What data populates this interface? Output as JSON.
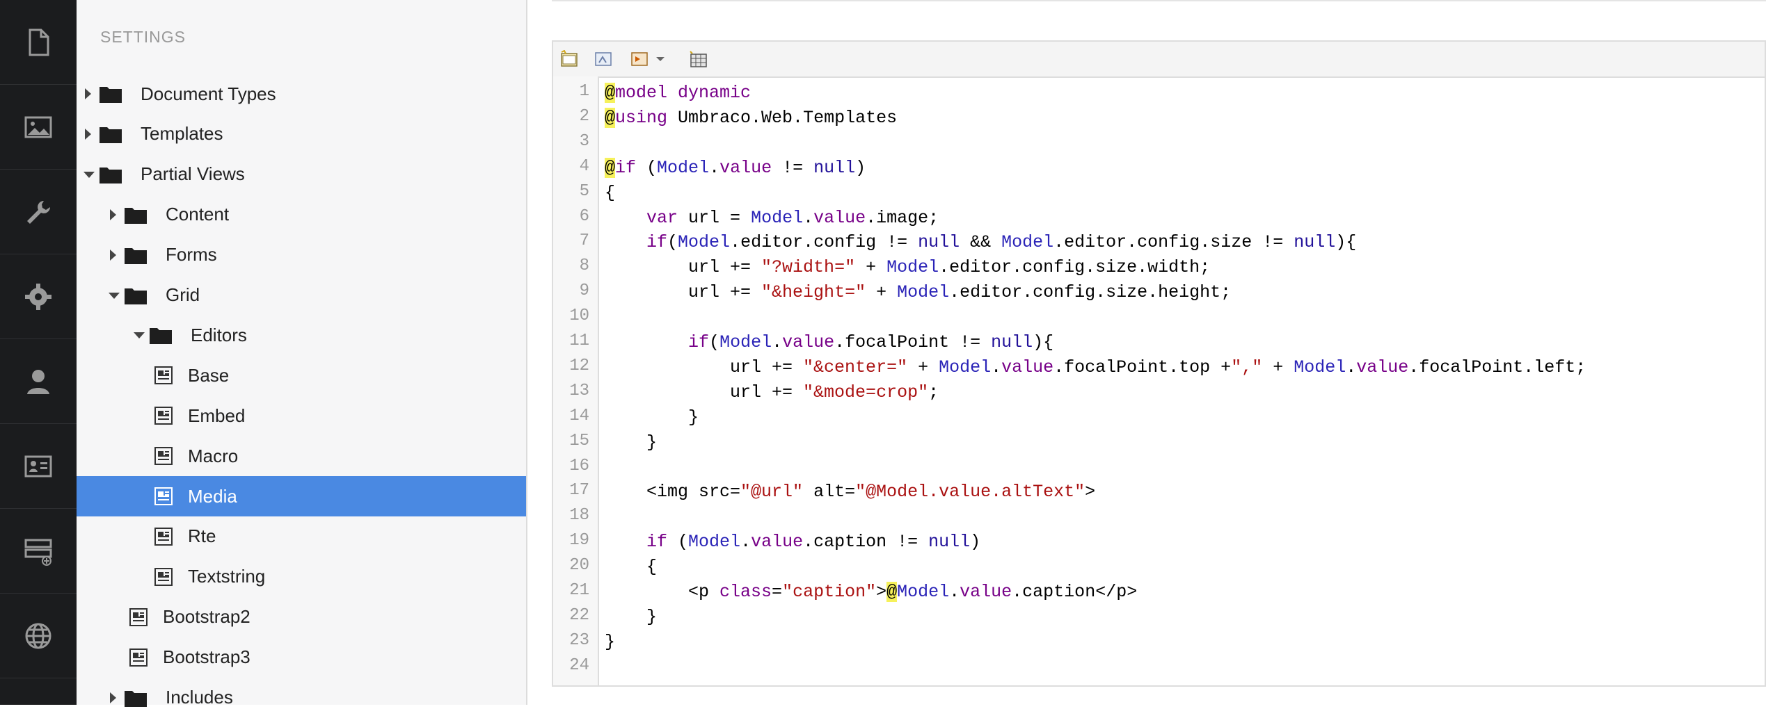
{
  "leftbar": {
    "icons": [
      "content-icon",
      "media-icon",
      "developer-icon",
      "settings-icon",
      "users-icon",
      "members-icon",
      "forms-icon",
      "translation-icon"
    ]
  },
  "tree": {
    "section_title": "SETTINGS",
    "items": [
      {
        "label": "Document Types",
        "type": "folder",
        "state": "collapsed",
        "depth": 0
      },
      {
        "label": "Templates",
        "type": "folder",
        "state": "collapsed",
        "depth": 0
      },
      {
        "label": "Partial Views",
        "type": "folder",
        "state": "expanded",
        "depth": 0
      },
      {
        "label": "Content",
        "type": "folder",
        "state": "collapsed",
        "depth": 1
      },
      {
        "label": "Forms",
        "type": "folder",
        "state": "collapsed",
        "depth": 1
      },
      {
        "label": "Grid",
        "type": "folder",
        "state": "expanded",
        "depth": 1
      },
      {
        "label": "Editors",
        "type": "folder",
        "state": "expanded",
        "depth": 2
      },
      {
        "label": "Base",
        "type": "file",
        "depth": 3
      },
      {
        "label": "Embed",
        "type": "file",
        "depth": 3
      },
      {
        "label": "Macro",
        "type": "file",
        "depth": 3
      },
      {
        "label": "Media",
        "type": "file",
        "depth": 3,
        "selected": true
      },
      {
        "label": "Rte",
        "type": "file",
        "depth": 3
      },
      {
        "label": "Textstring",
        "type": "file",
        "depth": 3
      },
      {
        "label": "Bootstrap2",
        "type": "file",
        "depth": 2
      },
      {
        "label": "Bootstrap3",
        "type": "file",
        "depth": 2
      },
      {
        "label": "Includes",
        "type": "folder",
        "state": "collapsed",
        "depth": 1
      }
    ]
  },
  "editor": {
    "toolbar_icons": [
      "insert-icon",
      "macro-icon",
      "query-icon",
      "dropdown-arrow-icon",
      "dictionary-icon"
    ],
    "line_numbers": [
      "1",
      "2",
      "3",
      "4",
      "5",
      "6",
      "7",
      "8",
      "9",
      "10",
      "11",
      "12",
      "13",
      "14",
      "15",
      "16",
      "17",
      "18",
      "19",
      "20",
      "21",
      "22",
      "23",
      "24"
    ],
    "lines": [
      "@model dynamic",
      "@using Umbraco.Web.Templates",
      "",
      "@if (Model.value != null)",
      "{",
      "    var url = Model.value.image;",
      "    if(Model.editor.config != null && Model.editor.config.size != null){",
      "        url += \"?width=\" + Model.editor.config.size.width;",
      "        url += \"&height=\" + Model.editor.config.size.height;",
      "",
      "        if(Model.value.focalPoint != null){",
      "            url += \"&center=\" + Model.value.focalPoint.top +\",\" + Model.value.focalPoint.left;",
      "            url += \"&mode=crop\";",
      "        }",
      "    }",
      "",
      "    <img src=\"@url\" alt=\"@Model.value.altText\">",
      "",
      "    if (Model.value.caption != null)",
      "    {",
      "        <p class=\"caption\">@Model.value.caption</p>",
      "    }",
      "}",
      ""
    ]
  }
}
